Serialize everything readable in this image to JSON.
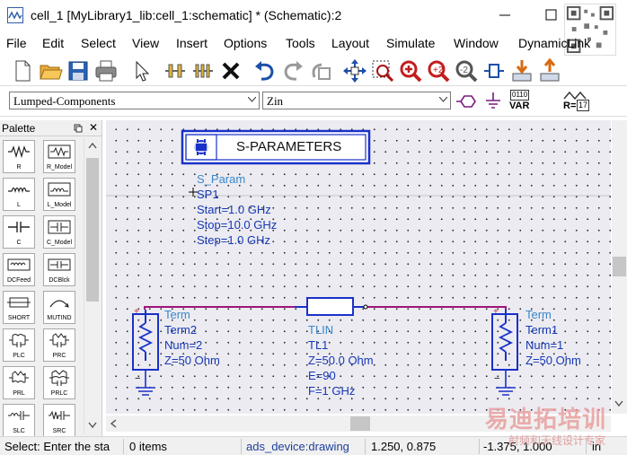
{
  "window": {
    "title": "cell_1 [MyLibrary1_lib:cell_1:schematic] * (Schematic):2"
  },
  "menu": [
    "File",
    "Edit",
    "Select",
    "View",
    "Insert",
    "Options",
    "Tools",
    "Layout",
    "Simulate",
    "Window",
    "DynamicLink"
  ],
  "toolbar2": {
    "library_combo": "Lumped-Components",
    "component_combo": "Zin",
    "var_label": "VAR",
    "var_code": "0110",
    "r_label": "R=",
    "r_value": "17"
  },
  "palette": {
    "title": "Palette",
    "pin_icon": "pin-icon",
    "close_label": "✕",
    "items": [
      {
        "label": "R",
        "icon": "resistor-icon"
      },
      {
        "label": "R_Model",
        "icon": "resistor-model-icon"
      },
      {
        "label": "L",
        "icon": "inductor-icon"
      },
      {
        "label": "L_Model",
        "icon": "inductor-model-icon"
      },
      {
        "label": "C",
        "icon": "capacitor-icon"
      },
      {
        "label": "C_Model",
        "icon": "capacitor-model-icon"
      },
      {
        "label": "DCFeed",
        "icon": "dcfeed-icon"
      },
      {
        "label": "DCBlck",
        "icon": "dcblock-icon"
      },
      {
        "label": "SHORT",
        "icon": "short-icon"
      },
      {
        "label": "MUTIND",
        "icon": "mutual-inductor-icon"
      },
      {
        "label": "PLC",
        "icon": "plc-icon"
      },
      {
        "label": "PRC",
        "icon": "prc-icon"
      },
      {
        "label": "PRL",
        "icon": "prl-icon"
      },
      {
        "label": "PRLC",
        "icon": "prlc-icon"
      },
      {
        "label": "SLC",
        "icon": "slc-icon"
      },
      {
        "label": "SRC",
        "icon": "src-icon"
      }
    ]
  },
  "schematic": {
    "sparam_block": {
      "title": "S-PARAMETERS",
      "type": "S_Param",
      "name": "SP1",
      "start": "Start=1.0 GHz",
      "stop": "Stop=10.0 GHz",
      "step": "Step=1.0 GHz"
    },
    "term2": {
      "type": "Term",
      "name": "Term2",
      "num": "Num=2",
      "z": "Z=50 Ohm"
    },
    "term1": {
      "type": "Term",
      "name": "Term1",
      "num": "Num=1",
      "z": "Z=50 Ohm"
    },
    "tlin": {
      "type": "TLIN",
      "name": "TL1",
      "z": "Z=50.0 Ohm",
      "e": "E=90",
      "f": "F=1 GHz"
    },
    "colors": {
      "wire": "#a0157a",
      "component": "#1a31c8",
      "label": "#1437b5",
      "param": "#333333"
    }
  },
  "status": {
    "select": "Select: Enter the sta",
    "items": "0 items",
    "context": "ads_device:drawing",
    "coord1": "1.250, 0.875",
    "coord2": "-1.375, 1.000",
    "unit": "in"
  },
  "watermark": {
    "main": "易迪拓培训",
    "sub": "射频和天线设计专家"
  }
}
